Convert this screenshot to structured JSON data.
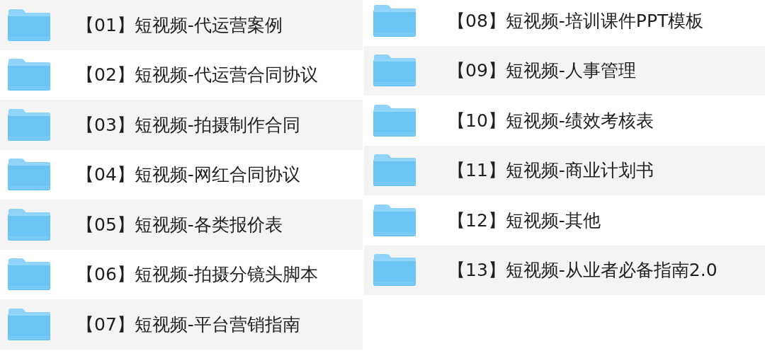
{
  "columns": [
    {
      "folders": [
        {
          "name": "【01】短视频-代运营案例"
        },
        {
          "name": "【02】短视频-代运营合同协议"
        },
        {
          "name": "【03】短视频-拍摄制作合同"
        },
        {
          "name": "【04】短视频-网红合同协议"
        },
        {
          "name": "【05】短视频-各类报价表"
        },
        {
          "name": "【06】短视频-拍摄分镜头脚本"
        },
        {
          "name": "【07】短视频-平台营销指南"
        }
      ]
    },
    {
      "folders": [
        {
          "name": "【08】短视频-培训课件PPT模板"
        },
        {
          "name": "【09】短视频-人事管理"
        },
        {
          "name": "【10】短视频-绩效考核表"
        },
        {
          "name": "【11】短视频-商业计划书"
        },
        {
          "name": "【12】短视频-其他"
        },
        {
          "name": "【13】短视频-从业者必备指南2.0"
        }
      ]
    }
  ]
}
